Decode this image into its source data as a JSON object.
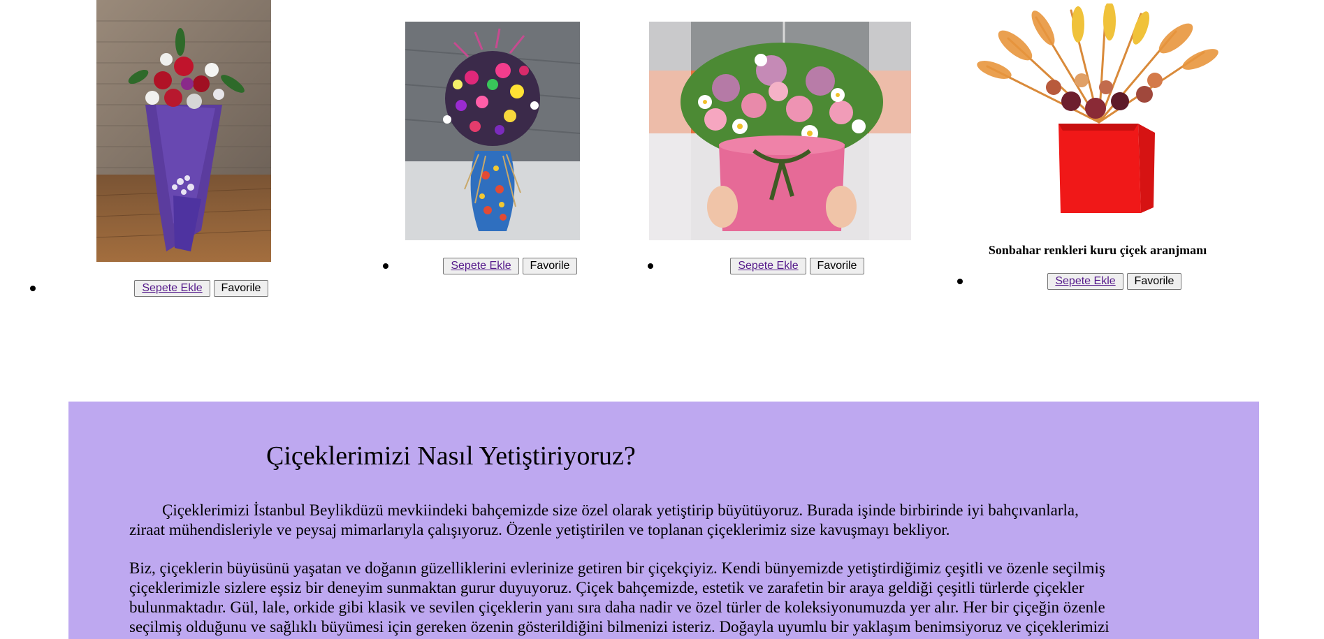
{
  "products": [
    {
      "name": "",
      "add_to_cart": "Sepete Ekle",
      "favorite": "Favorile"
    },
    {
      "name": "",
      "add_to_cart": "Sepete Ekle",
      "favorite": "Favorile"
    },
    {
      "name": "",
      "add_to_cart": "Sepete Ekle",
      "favorite": "Favorile"
    },
    {
      "name": "Sonbahar renkleri kuru çiçek aranjmanı",
      "add_to_cart": "Sepete Ekle",
      "favorite": "Favorile"
    }
  ],
  "about": {
    "title": "Çiçeklerimizi Nasıl Yetiştiriyoruz?",
    "p1_line1": "Çiçeklerimizi İstanbul Beylikdüzü mevkiindeki bahçemizde size özel olarak yetiştirip büyütüyoruz. Burada işinde birbirinde iyi bahçıvanlarla,",
    "p1_line2": "ziraat mühendisleriyle ve peysaj mimarlarıyla çalışıyoruz. Özenle yetiştirilen ve toplanan çiçeklerimiz size kavuşmayı bekliyor.",
    "p2_line1": "Biz, çiçeklerin büyüsünü yaşatan ve doğanın güzelliklerini evlerinize getiren bir çiçekçiyiz. Kendi bünyemizde yetiştirdiğimiz çeşitli ve özenle seçilmiş",
    "p2_line2": "çiçeklerimizle sizlere eşsiz bir deneyim sunmaktan gurur duyuyoruz. Çiçek bahçemizde, estetik ve zarafetin bir araya geldiği çeşitli türlerde çiçekler",
    "p2_line3": "bulunmaktadır. Gül, lale, orkide gibi klasik ve sevilen çiçeklerin yanı sıra daha nadir ve özel türler de koleksiyonumuzda yer alır. Her bir çiçeğin özenle",
    "p2_line4": "seçilmiş olduğunu ve sağlıklı büyümesi için gereken özenin gösterildiğini bilmenizi isteriz. Doğayla uyumlu bir yaklaşım benimsiyoruz ve çiçeklerimizi"
  },
  "colors": {
    "about_background": "#bea8f0",
    "link": "#551a8b"
  }
}
